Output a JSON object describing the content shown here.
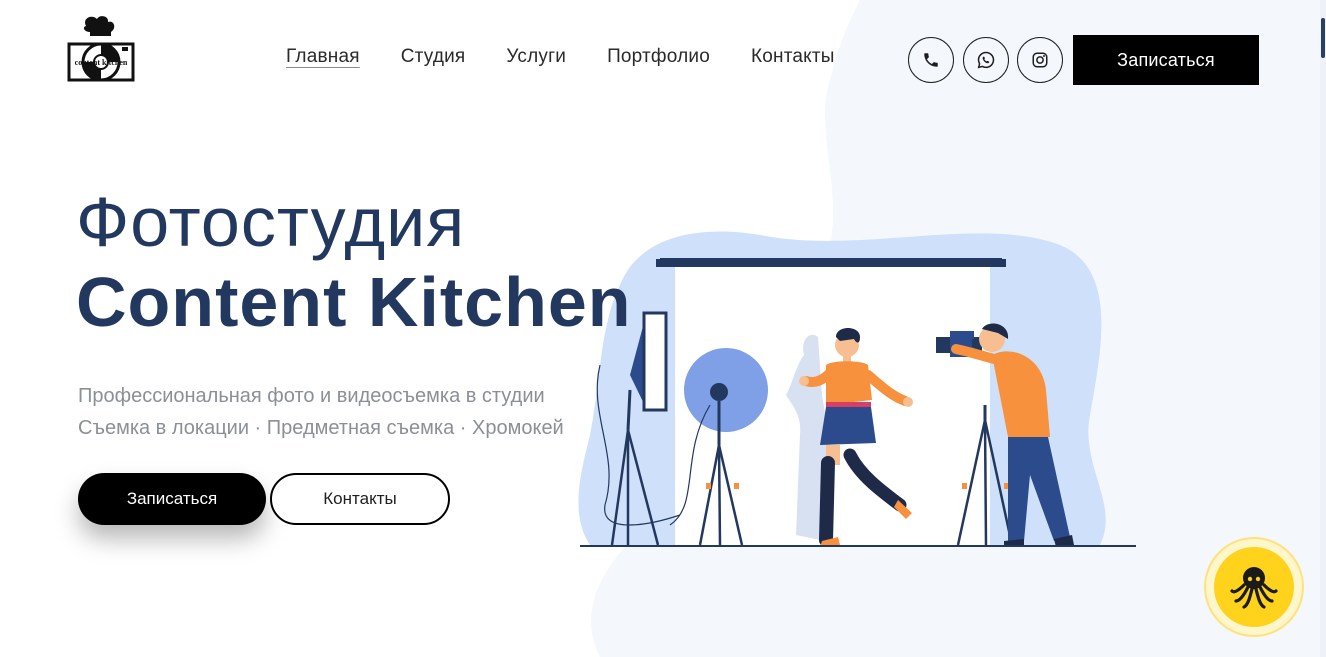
{
  "colors": {
    "title": "#22385e",
    "subtitle": "#8b8f96",
    "primary": "#000000",
    "widget": "#ffd21c",
    "illustration_blue": "#cfe0fb",
    "illustration_orange": "#f7913d"
  },
  "header": {
    "logo": {
      "text": "content kitchen",
      "icon": "chef-hat-camera-logo"
    },
    "nav": [
      {
        "label": "Главная",
        "active": true
      },
      {
        "label": "Студия",
        "active": false
      },
      {
        "label": "Услуги",
        "active": false
      },
      {
        "label": "Портфолио",
        "active": false
      },
      {
        "label": "Контакты",
        "active": false
      }
    ],
    "icons": [
      "phone-icon",
      "whatsapp-icon",
      "instagram-icon"
    ],
    "cta_label": "Записаться"
  },
  "hero": {
    "title_line1": "Фотостудия",
    "title_line2": "Content Kitchen",
    "subtitle_line1": "Профессиональная фото и видеосъемка в студии",
    "subtitle_line2": "Съемка в локации · Предметная съемка · Хромокей",
    "primary_button": "Записаться",
    "secondary_button": "Контакты"
  },
  "widget": {
    "icon": "octopus-icon"
  }
}
